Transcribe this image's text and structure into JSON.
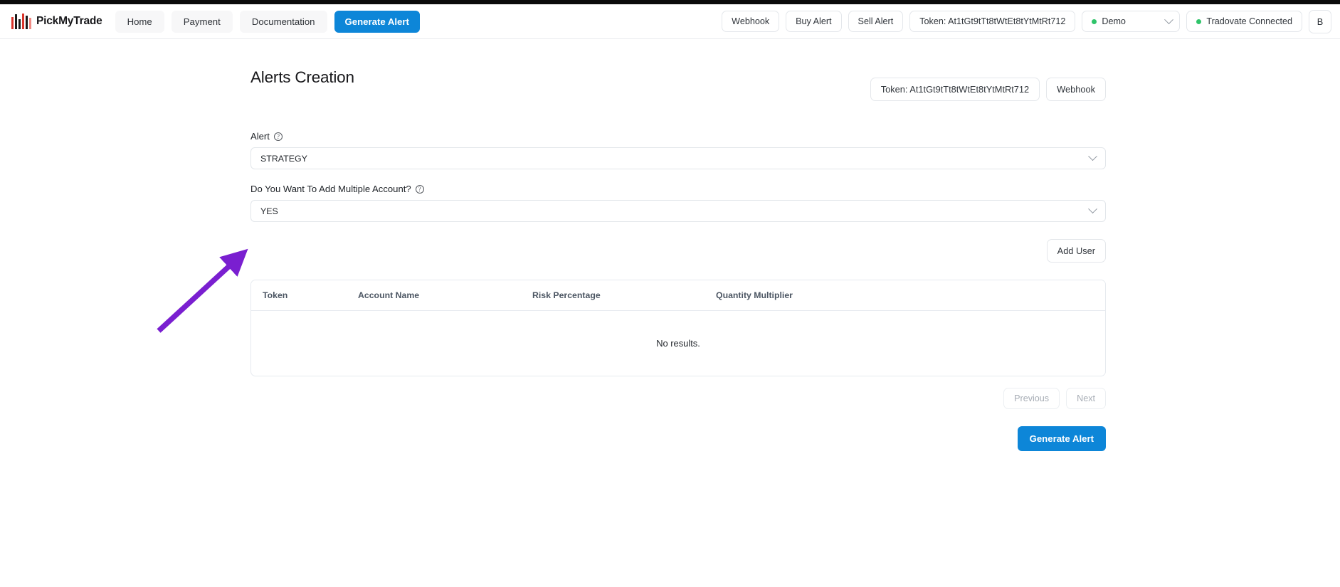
{
  "brand": {
    "name": "PickMyTrade",
    "logo_icon": "bar-chart-logo-icon"
  },
  "navbar": {
    "links": [
      {
        "label": "Home",
        "name": "nav-home"
      },
      {
        "label": "Payment",
        "name": "nav-payment"
      },
      {
        "label": "Documentation",
        "name": "nav-documentation"
      }
    ],
    "primary_label": "Generate Alert",
    "right": {
      "webhook_label": "Webhook",
      "buy_alert_label": "Buy Alert",
      "sell_alert_label": "Sell Alert",
      "token_label": "Token: At1tGt9tTt8tWtEt8tYtMtRt712",
      "environment_value": "Demo",
      "connection_status": "Tradovate Connected",
      "avatar_initial": "B"
    }
  },
  "page": {
    "title": "Alerts Creation",
    "header_actions": {
      "token_label": "Token: At1tGt9tTt8tWtEt8tYtMtRt712",
      "webhook_label": "Webhook"
    },
    "form": {
      "alert": {
        "label": "Alert",
        "help_glyph": "?",
        "value": "STRATEGY"
      },
      "multiple_account": {
        "label": "Do You Want To Add Multiple Account?",
        "help_glyph": "?",
        "value": "YES"
      },
      "add_user_label": "Add User"
    },
    "table": {
      "columns": [
        "Token",
        "Account Name",
        "Risk Percentage",
        "Quantity Multiplier"
      ],
      "rows": [],
      "empty_message": "No results."
    },
    "pagination": {
      "previous_label": "Previous",
      "next_label": "Next"
    },
    "submit_label": "Generate Alert"
  },
  "annotation": {
    "type": "arrow",
    "color": "#7A1FD0",
    "points_to": "multiple-account-select"
  },
  "colors": {
    "accent_blue": "#0D86D8",
    "status_green": "#2FC46A",
    "annotation_purple": "#7A1FD0",
    "top_strip": "#0A0A0A"
  }
}
